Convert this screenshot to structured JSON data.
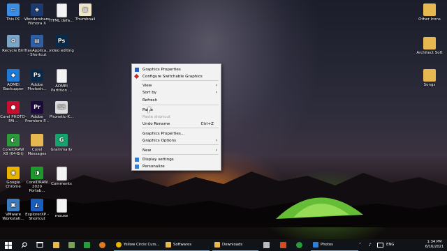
{
  "desktop_icons": [
    {
      "label": "This PC",
      "icon": "computer-icon",
      "color": "#3a8ee6"
    },
    {
      "label": "Recycle Bin",
      "icon": "recycle-bin-icon",
      "color": "#7aa7c7"
    },
    {
      "label": "AOMEI Backupper",
      "icon": "aomei-icon",
      "color": "#1f7ad6"
    },
    {
      "label": "Corel PHOTO-PAI...",
      "icon": "corel-photo-paint-icon",
      "color": "#c8102e"
    },
    {
      "label": "CorelDRAW X8 (64-Bit)",
      "icon": "coreldraw-icon",
      "color": "#2a9a3a"
    },
    {
      "label": "Google Chrome",
      "icon": "chrome-icon",
      "color": "#e8b400"
    },
    {
      "label": "VMware Workstati...",
      "icon": "vmware-icon",
      "color": "#3b7bbf"
    },
    {
      "label": "Wondershare Filmora X",
      "icon": "filmora-icon",
      "color": "#1c3b6e"
    },
    {
      "label": "TrayApplica... - Shortcut",
      "icon": "tray-app-icon",
      "color": "#2f5fa5"
    },
    {
      "label": "Adobe Photosh...",
      "icon": "photoshop-icon",
      "color": "#0a2a4a"
    },
    {
      "label": "Adobe Premiere P...",
      "icon": "premiere-icon",
      "color": "#1e0a3c"
    },
    {
      "label": "Corel Messages",
      "icon": "folder-icon",
      "color": "#e6b84f"
    },
    {
      "label": "CorelDRAW 2020 Portab...",
      "icon": "coreldraw-portable-icon",
      "color": "#1d9a2c"
    },
    {
      "label": "ExplorerXP - Shortcut",
      "icon": "explorerxp-icon",
      "color": "#1a5fbf"
    },
    {
      "label": "HTML defa...",
      "icon": "html-file-icon",
      "color": "#f3f3f3"
    },
    {
      "label": "video editing",
      "icon": "photoshop-file-icon",
      "color": "#0a2a4a"
    },
    {
      "label": "AOMEI Partition ...",
      "icon": "document-icon",
      "color": "#f3f3f3"
    },
    {
      "label": "Phonetic-K...",
      "icon": "phonetic-icon",
      "color": "#dddddd"
    },
    {
      "label": "Grammarly",
      "icon": "grammarly-icon",
      "color": "#15a46e"
    },
    {
      "label": "Comments",
      "icon": "document-icon",
      "color": "#f3f3f3"
    },
    {
      "label": "mouse",
      "icon": "document-icon",
      "color": "#f3f3f3"
    },
    {
      "label": "Thumbnail",
      "icon": "image-file-icon",
      "color": "#efe6c8"
    },
    {
      "label": "Other Icons",
      "icon": "folder-icon",
      "color": "#e6b84f"
    },
    {
      "label": "Architect Soft",
      "icon": "folder-icon",
      "color": "#e6b84f"
    },
    {
      "label": "Songs",
      "icon": "folder-icon",
      "color": "#e6b84f"
    }
  ],
  "icon_glyphs": {
    "computer-icon": "▭",
    "recycle-bin-icon": "♻",
    "aomei-icon": "◆",
    "corel-photo-paint-icon": "●",
    "coreldraw-icon": "◐",
    "chrome-icon": "◉",
    "vmware-icon": "▣",
    "filmora-icon": "◈",
    "tray-app-icon": "▤",
    "photoshop-icon": "Ps",
    "premiere-icon": "Pr",
    "folder-icon": "",
    "coreldraw-portable-icon": "◑",
    "explorerxp-icon": "◭",
    "html-file-icon": "",
    "photoshop-file-icon": "Ps",
    "document-icon": "",
    "phonetic-icon": "⌨",
    "grammarly-icon": "G",
    "image-file-icon": "▦"
  },
  "context_menu": {
    "items": [
      {
        "label": "Graphics Properties",
        "icon": "intel-graphics-icon",
        "color": "#2060c0"
      },
      {
        "label": "Configure Switchable Graphics",
        "icon": "amd-icon",
        "color": "#d02020"
      },
      {
        "label": "View",
        "submenu": "›"
      },
      {
        "label": "Sort by",
        "submenu": "›"
      },
      {
        "label": "Refresh"
      },
      {
        "label": "Paste"
      },
      {
        "label": "Paste shortcut",
        "disabled": true
      },
      {
        "label": "Undo Rename",
        "shortcut": "Ctrl+Z"
      },
      {
        "label": "Graphics Properties..."
      },
      {
        "label": "Graphics Options",
        "submenu": "›"
      },
      {
        "label": "New",
        "submenu": "›"
      },
      {
        "label": "Display settings",
        "icon": "display-icon",
        "color": "#2f7fd6"
      },
      {
        "label": "Personalize",
        "icon": "personalize-icon",
        "color": "#2f7fd6"
      }
    ]
  },
  "taskbar": {
    "apps": [
      {
        "label": "Yellow Circle Curs...",
        "icon": "chrome-icon",
        "color": "#e8b400"
      },
      {
        "label": "Softwares",
        "icon": "folder-icon",
        "color": "#e6b84f"
      },
      {
        "label": "Downloads",
        "icon": "folder-icon",
        "color": "#e6b84f"
      },
      {
        "label": "Photos",
        "icon": "photos-icon",
        "color": "#2f7fd6"
      }
    ],
    "tray_language": "ENG",
    "time": "1:34 PM",
    "date": "6/16/2021"
  }
}
